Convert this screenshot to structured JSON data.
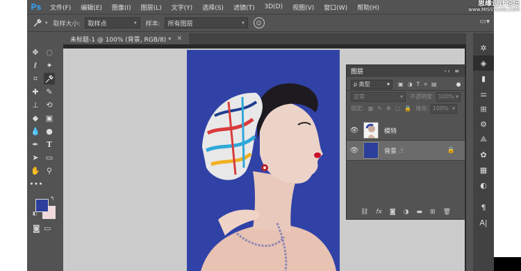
{
  "app": {
    "logo": "Ps",
    "window_controls": [
      "—",
      "□",
      "✕"
    ]
  },
  "watermark": {
    "cn": "思缘设计论坛",
    "en": "www.MISSYUAN.COM"
  },
  "menu": [
    "文件(F)",
    "编辑(E)",
    "图像(I)",
    "图层(L)",
    "文字(Y)",
    "选择(S)",
    "滤镜(T)",
    "3D(D)",
    "视图(V)",
    "窗口(W)",
    "帮助(H)"
  ],
  "options": {
    "sample_size_label": "取样大小:",
    "sample_size_value": "取样点",
    "sample_label": "样本:",
    "sample_value": "所有图层"
  },
  "document": {
    "tab_title": "未标题-1 @ 100% (背景, RGB/8) *"
  },
  "layers_panel": {
    "title": "图层",
    "filter_kind": "ρ 类型",
    "blend_mode": "正常",
    "opacity_label": "不透明度:",
    "opacity_value": "100%",
    "lock_label": "锁定:",
    "fill_label": "填充:",
    "fill_value": "100%",
    "layers": [
      {
        "name": "模特",
        "visible": true,
        "selected": false,
        "locked": false
      },
      {
        "name": "背景",
        "visible": true,
        "selected": true,
        "locked": true,
        "color": "#2b3f9a"
      }
    ]
  },
  "colors": {
    "foreground": "#2b3f9a",
    "background": "#f4d9dc",
    "accent": "#31a8ff"
  }
}
